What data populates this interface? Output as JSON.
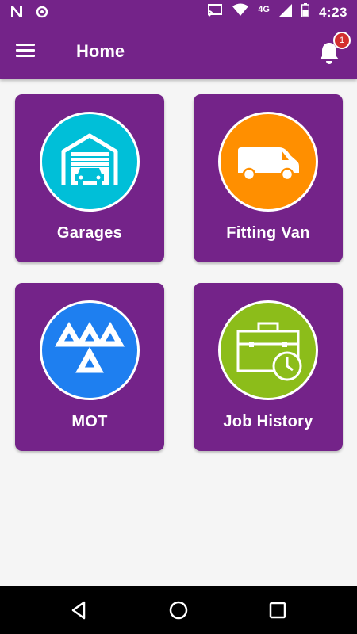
{
  "status_bar": {
    "time": "4:23",
    "network": "4G",
    "icons": [
      "n-icon",
      "sync-icon",
      "cast-icon",
      "wifi-icon",
      "signal-icon",
      "battery-icon"
    ]
  },
  "app_bar": {
    "title": "Home",
    "notification_count": "1"
  },
  "tiles": [
    {
      "label": "Garages",
      "icon": "garage-icon",
      "color": "#00bfd8"
    },
    {
      "label": "Fitting Van",
      "icon": "van-icon",
      "color": "#ff8f00"
    },
    {
      "label": "MOT",
      "icon": "mot-icon",
      "color": "#1e7ff0"
    },
    {
      "label": "Job History",
      "icon": "briefcase-clock-icon",
      "color": "#8cbd1a"
    }
  ],
  "colors": {
    "primary": "#742389",
    "background": "#f5f5f5",
    "badge": "#d32f2f"
  },
  "nav_bar": {
    "icons": [
      "back-icon",
      "home-icon",
      "recent-apps-icon"
    ]
  }
}
